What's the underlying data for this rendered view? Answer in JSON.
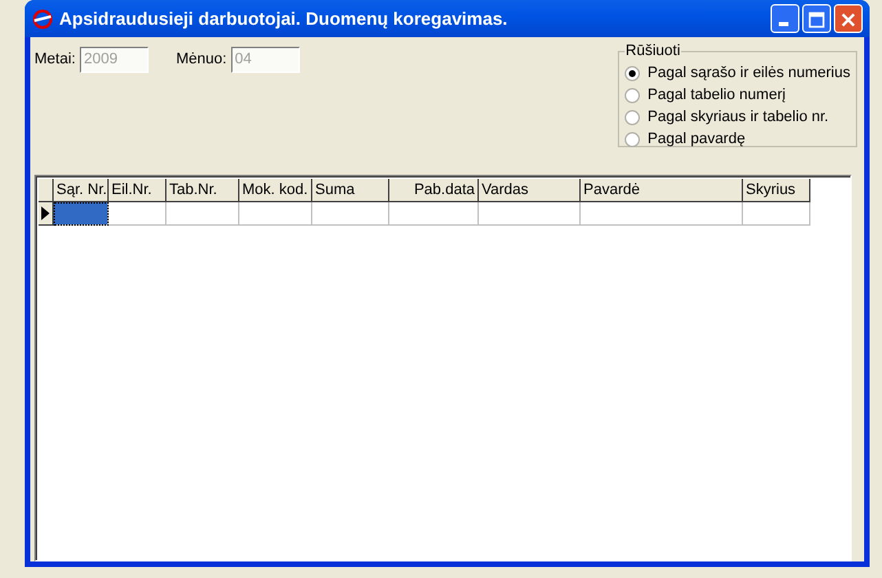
{
  "window": {
    "title": "Apsidraudusieji darbuotojai. Duomenų koregavimas."
  },
  "fields": [
    {
      "label": "Metai:",
      "value": "2009",
      "disabled": true
    },
    {
      "label": "Mėnuo:",
      "value": "04",
      "disabled": true
    }
  ],
  "sort_group": {
    "title": "Rūšiuoti",
    "options": [
      {
        "label": "Pagal sąrašo ir eilės numerius",
        "selected": true
      },
      {
        "label": "Pagal tabelio numerį",
        "selected": false
      },
      {
        "label": "Pagal skyriaus ir tabelio nr.",
        "selected": false
      },
      {
        "label": "Pagal pavardę",
        "selected": false
      }
    ]
  },
  "table": {
    "columns": [
      "Sąr. Nr.",
      "Eil.Nr.",
      "Tab.Nr.",
      "Mok. kod.",
      "Suma",
      "Pab.data",
      "Vardas",
      "Pavardė",
      "Skyrius"
    ],
    "rows": [
      {
        "current": true,
        "cells": [
          {
            "selected": true
          },
          {
            "selected": false
          },
          {
            "selected": false
          },
          {
            "selected": false
          },
          {
            "selected": false
          },
          {
            "selected": false
          },
          {
            "selected": false
          },
          {
            "selected": false
          },
          {
            "selected": false
          }
        ]
      }
    ]
  }
}
